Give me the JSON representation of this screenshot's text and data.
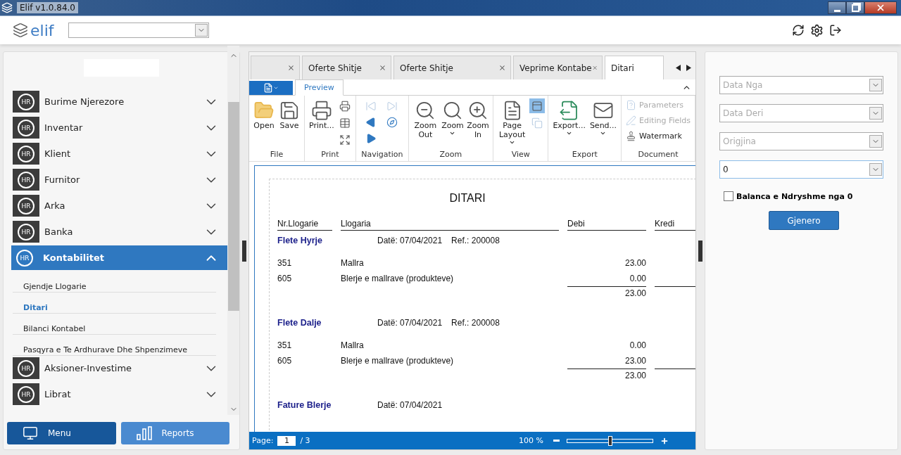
{
  "window": {
    "title": "Elif v1.0.84.0"
  },
  "header": {
    "logo": "elif"
  },
  "sidebar": {
    "items": [
      {
        "badge": "HR",
        "label": "Burime Njerezore",
        "expanded": false
      },
      {
        "badge": "HR",
        "label": "Inventar",
        "expanded": false
      },
      {
        "badge": "HR",
        "label": "Klient",
        "expanded": false
      },
      {
        "badge": "HR",
        "label": "Furnitor",
        "expanded": false
      },
      {
        "badge": "HR",
        "label": "Arka",
        "expanded": false
      },
      {
        "badge": "HR",
        "label": "Banka",
        "expanded": false
      },
      {
        "badge": "HR",
        "label": "Kontabilitet",
        "expanded": true,
        "children": [
          {
            "label": "Gjendje Llogarie",
            "selected": false
          },
          {
            "label": "Ditari",
            "selected": true
          },
          {
            "label": "Bilanci Kontabel",
            "selected": false
          },
          {
            "label": "Pasqyra e Te Ardhurave Dhe Shpenzimeve",
            "selected": false
          }
        ]
      },
      {
        "badge": "HR",
        "label": "Aksioner-Investime",
        "expanded": false
      },
      {
        "badge": "HR",
        "label": "Librat",
        "expanded": false
      }
    ],
    "buttons": [
      {
        "label": "Menu",
        "selected": true
      },
      {
        "label": "Reports",
        "selected": false
      }
    ]
  },
  "tabs": [
    {
      "selected": false
    },
    {
      "label": "Oferte Shitje",
      "selected": false
    },
    {
      "label": "Oferte Shitje",
      "selected": false
    },
    {
      "label": "Veprime Kontabe",
      "selected": false
    },
    {
      "label": "Ditari",
      "selected": true
    }
  ],
  "ribbon": {
    "tabs": [
      {
        "label": "Preview",
        "selected": true
      }
    ],
    "groups": [
      {
        "label": "File",
        "buttons": [
          {
            "kind": "large",
            "label": "Open",
            "disabled": false
          },
          {
            "kind": "large",
            "label": "Save",
            "disabled": false
          }
        ]
      },
      {
        "label": "Print",
        "buttons": [
          {
            "kind": "large",
            "label": "Print...",
            "disabled": false
          },
          {
            "kind": "icon",
            "disabled": false
          },
          {
            "kind": "icon",
            "disabled": false
          },
          {
            "kind": "icon",
            "disabled": false
          }
        ]
      },
      {
        "label": "Navigation",
        "buttons": [
          {
            "kind": "icon",
            "disabled": true
          },
          {
            "kind": "icon",
            "disabled": true
          },
          {
            "kind": "icon",
            "disabled": false
          },
          {
            "kind": "icon",
            "disabled": false
          },
          {
            "kind": "icon",
            "disabled": false
          }
        ]
      },
      {
        "label": "Zoom",
        "buttons": [
          {
            "kind": "large",
            "label": "Zoom Out",
            "disabled": false
          },
          {
            "kind": "large",
            "label": "Zoom",
            "dropdown": true,
            "disabled": false
          },
          {
            "kind": "large",
            "label": "Zoom In",
            "disabled": false
          }
        ]
      },
      {
        "label": "View",
        "buttons": [
          {
            "kind": "large",
            "label": "Page Layout",
            "dropdown": true,
            "disabled": false
          },
          {
            "kind": "icon",
            "disabled": false,
            "selected": true
          },
          {
            "kind": "icon",
            "disabled": true,
            "selected": false
          }
        ]
      },
      {
        "label": "Export",
        "buttons": [
          {
            "kind": "large",
            "label": "Export...",
            "dropdown": true,
            "disabled": false
          },
          {
            "kind": "large",
            "label": "Send...",
            "dropdown": true,
            "disabled": false
          }
        ]
      },
      {
        "label": "Document",
        "buttons": [
          {
            "kind": "small",
            "label": "Parameters",
            "disabled": true
          },
          {
            "kind": "small",
            "label": "Editing Fields",
            "disabled": true
          },
          {
            "kind": "small",
            "label": "Watermark",
            "disabled": false
          }
        ]
      }
    ]
  },
  "report": {
    "title": "DITARI",
    "columns": [
      "Nr.Llogarie",
      "Llogaria",
      "Debi",
      "Kredi"
    ],
    "sections": [
      {
        "title": "Flete Hyrje",
        "date": "Datë: 07/04/2021",
        "ref": "Ref.: 200008",
        "rows": [
          {
            "account": "351",
            "name": "Mallra",
            "debit": "23.00"
          },
          {
            "account": "605",
            "name": "Blerje e mallrave (produkteve)",
            "debit": "0.00"
          }
        ],
        "total": "23.00"
      },
      {
        "title": "Flete Dalje",
        "date": "Datë: 07/04/2021",
        "ref": "Ref.: 200008",
        "rows": [
          {
            "account": "351",
            "name": "Mallra",
            "debit": "0.00"
          },
          {
            "account": "605",
            "name": "Blerje e mallrave (produkteve)",
            "debit": "23.00"
          }
        ],
        "total": "23.00"
      },
      {
        "title": "Fature Blerje",
        "date": "Datë: 07/04/2021"
      }
    ]
  },
  "status_bar": {
    "page_label": "Page:",
    "page": "1",
    "page_total": "/ 3",
    "zoom": "100 %",
    "zoom_slider": {
      "level": 0.5
    }
  },
  "filters": [
    {
      "placeholder": "Data Nga",
      "focused": false
    },
    {
      "placeholder": "Data Deri",
      "focused": false
    },
    {
      "placeholder": "Origjina",
      "focused": false
    },
    {
      "value": "0",
      "focused": true
    }
  ],
  "checkbox": {
    "label": "Balanca e Ndryshme nga 0",
    "checked": false
  },
  "generate_button": "Gjenero"
}
